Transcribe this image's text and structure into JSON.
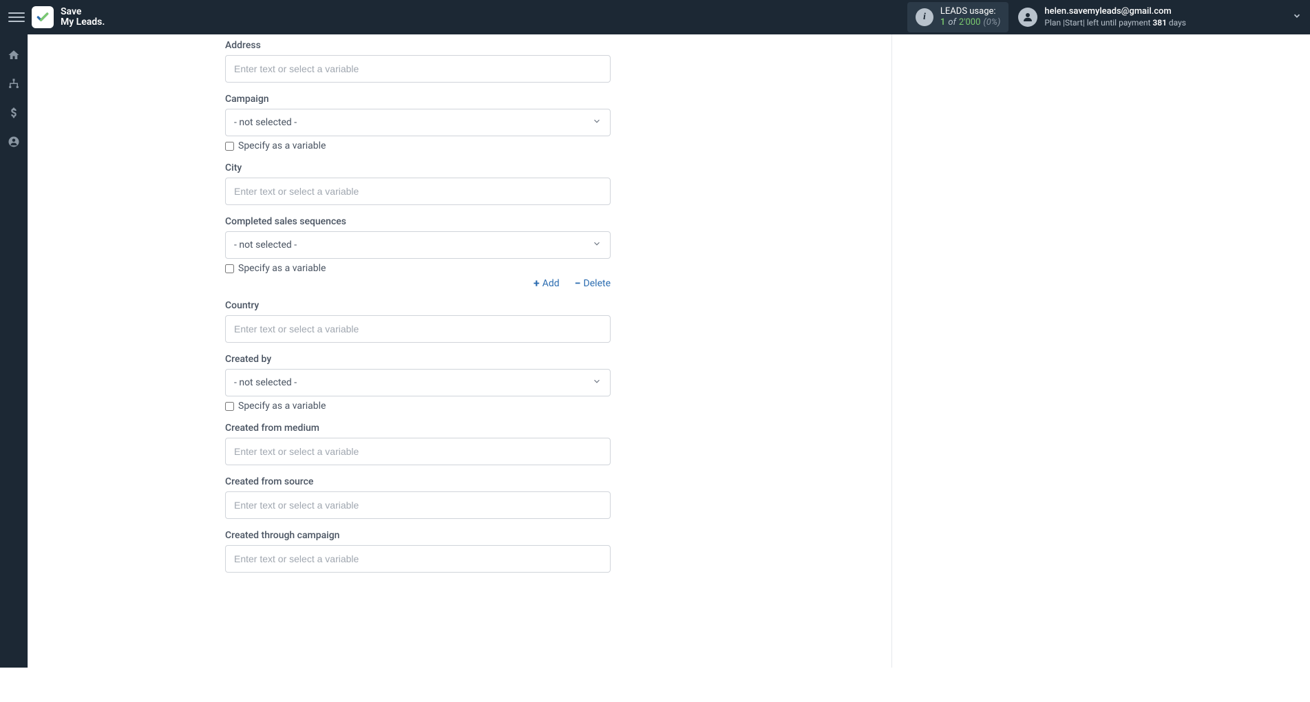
{
  "logo": {
    "line1": "Save",
    "line2": "My Leads."
  },
  "usage": {
    "title": "LEADS usage:",
    "count": "1",
    "of": "of",
    "total": "2'000",
    "pct": "(0%)"
  },
  "user": {
    "email": "helen.savemyleads@gmail.com",
    "plan_prefix": "Plan |Start| left until payment ",
    "days_num": "381",
    "days_suffix": " days"
  },
  "form": {
    "placeholder": "Enter text or select a variable",
    "not_selected": "- not selected -",
    "specify_label": "Specify as a variable",
    "add_label": "Add",
    "delete_label": "Delete",
    "fields": {
      "address": "Address",
      "campaign": "Campaign",
      "city": "City",
      "completed_sales": "Completed sales sequences",
      "country": "Country",
      "created_by": "Created by",
      "created_from_medium": "Created from medium",
      "created_from_source": "Created from source",
      "created_through_campaign": "Created through campaign"
    }
  }
}
